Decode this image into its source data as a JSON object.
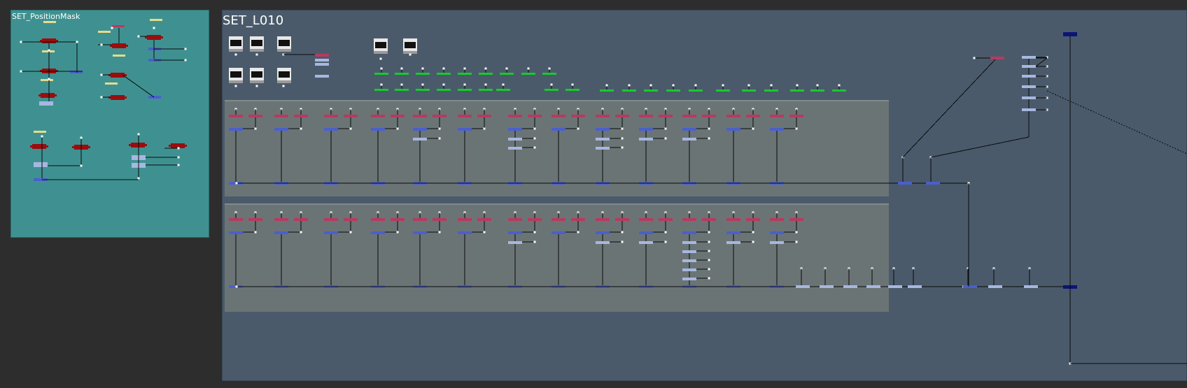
{
  "backdrops": {
    "position_mask": {
      "label": "SET_PositionMask",
      "color": "#3f9191"
    },
    "main": {
      "label": "SET_L010",
      "color": "#4a5a6b"
    }
  },
  "colors": {
    "crimson": "#b83a5e",
    "darkred": "#9b0d0d",
    "blue": "#4a5fcf",
    "lightblue": "#a6b8e0",
    "green": "#19c92c",
    "yellow": "#e6dc8a",
    "navy": "#0d1478",
    "wire": "#0a0a0a"
  }
}
